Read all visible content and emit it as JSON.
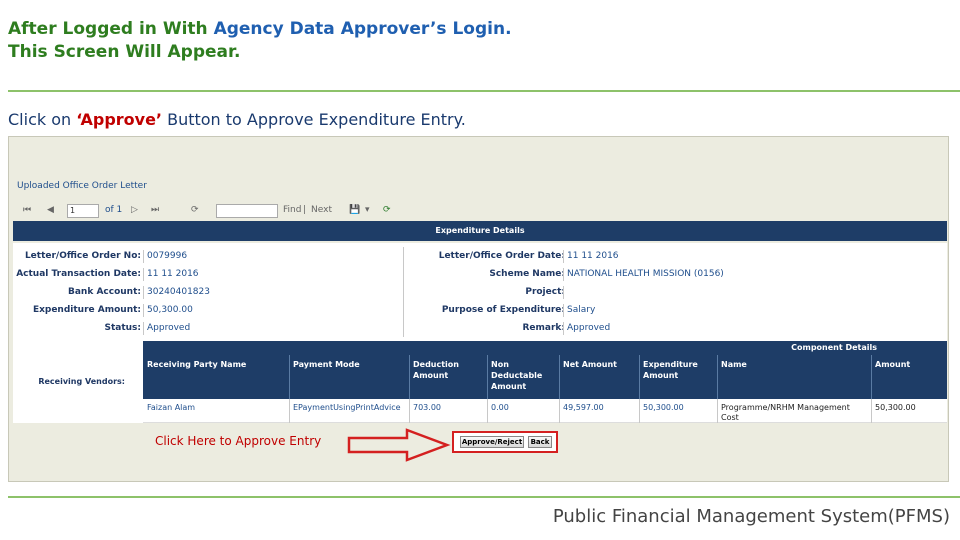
{
  "slide": {
    "title_line1_pre": "After Logged in With ",
    "title_line1_accent": "Agency Data Approver’s Login.",
    "title_line2": "This Screen Will Appear.",
    "instruction_pre": "Click on ",
    "instruction_red": "‘Approve’",
    "instruction_post": " Button to Approve Expenditure Entry.",
    "footer": "Public Financial Management System(PFMS)"
  },
  "screenshot": {
    "uploaded_label": "Uploaded Office Order Letter",
    "toolbar": {
      "first": "⏮",
      "prev": "◀",
      "page": "1",
      "of_label": "of 1",
      "next": "▷",
      "last": "⏭",
      "refresh_icon": "⟳",
      "find": "Find",
      "separator": "|",
      "next_label": "Next",
      "export_icon": "💾",
      "export_arrow": "▾"
    },
    "expenditure_header": "Expenditure Details",
    "left_fields": [
      {
        "label": "Letter/Office Order No:",
        "value": "0079996"
      },
      {
        "label": "Actual Transaction Date:",
        "value": "11 11 2016"
      },
      {
        "label": "Bank Account:",
        "value": "30240401823"
      },
      {
        "label": "Expenditure Amount:",
        "value": "50,300.00"
      },
      {
        "label": "Status:",
        "value": "Approved"
      }
    ],
    "right_fields": [
      {
        "label": "Letter/Office Order Date:",
        "value": "11 11 2016"
      },
      {
        "label": "Scheme Name:",
        "value": "NATIONAL HEALTH MISSION (0156)"
      },
      {
        "label": "Project:",
        "value": ""
      },
      {
        "label": "Purpose of Expenditure:",
        "value": "Salary"
      },
      {
        "label": "Remark:",
        "value": "Approved"
      }
    ],
    "receiving_vendors_label": "Receiving Vendors:",
    "component_details_header": "Component Details",
    "columns": [
      "Receiving Party Name",
      "Payment Mode",
      "Deduction Amount",
      "Non Deductable Amount",
      "Net Amount",
      "Expenditure Amount",
      "Name",
      "Amount"
    ],
    "row": [
      "Faizan Alam",
      "EPaymentUsingPrintAdvice",
      "703.00",
      "0.00",
      "49,597.00",
      "50,300.00",
      "Programme/NRHM Management Cost",
      "50,300.00"
    ],
    "click_note": "Click Here to Approve Entry",
    "approve_button": "Approve/Reject",
    "back_button": "Back"
  }
}
